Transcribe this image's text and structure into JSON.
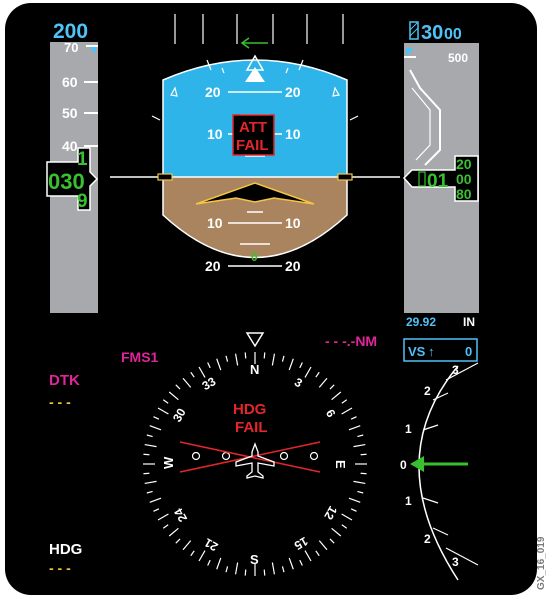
{
  "speed": {
    "selected": "200",
    "ticks": [
      "70",
      "60",
      "50",
      "40"
    ],
    "current_hundreds": "030",
    "drum_upper": "1",
    "drum_lower": "9"
  },
  "altitude": {
    "selected_thousands": "30",
    "selected_hundreds": "00",
    "tape_label": "500",
    "current_thousands": "01",
    "drum_upper": "20",
    "drum_mid": "00",
    "drum_lower": "80",
    "baro_value": "29.92",
    "baro_unit": "IN"
  },
  "vs": {
    "label": "VS",
    "value": "0"
  },
  "attitude": {
    "pitch_up_20": "20",
    "pitch_up_10": "10",
    "pitch_dn_10": "10",
    "pitch_dn_20": "20",
    "fail_line1": "ATT",
    "fail_line2": "FAIL",
    "slip_value": "0"
  },
  "hsi": {
    "source": "FMS1",
    "distance": "- - -.-NM",
    "fail_line1": "HDG",
    "fail_line2": "FAIL",
    "cardinals": {
      "N": "N",
      "E": "E",
      "S": "S",
      "W": "W"
    },
    "numbers": {
      "n3": "3",
      "n6": "6",
      "n12": "12",
      "n15": "15",
      "n21": "21",
      "n24": "24",
      "n30": "30",
      "n33": "33"
    }
  },
  "dtk": {
    "label": "DTK",
    "value": "- - -"
  },
  "hdg": {
    "label": "HDG",
    "value": "- - -"
  },
  "vsi": {
    "labels": [
      "3",
      "2",
      "1",
      "0",
      "1",
      "2",
      "3"
    ]
  },
  "figure_id": "GX_16_019",
  "colors": {
    "sky": "#2fb4e9",
    "ground": "#a9845e",
    "cyan": "#4fc3f7",
    "green": "#39c030",
    "magenta": "#e0259a",
    "red": "#e3262c",
    "amber": "#f5c542"
  }
}
